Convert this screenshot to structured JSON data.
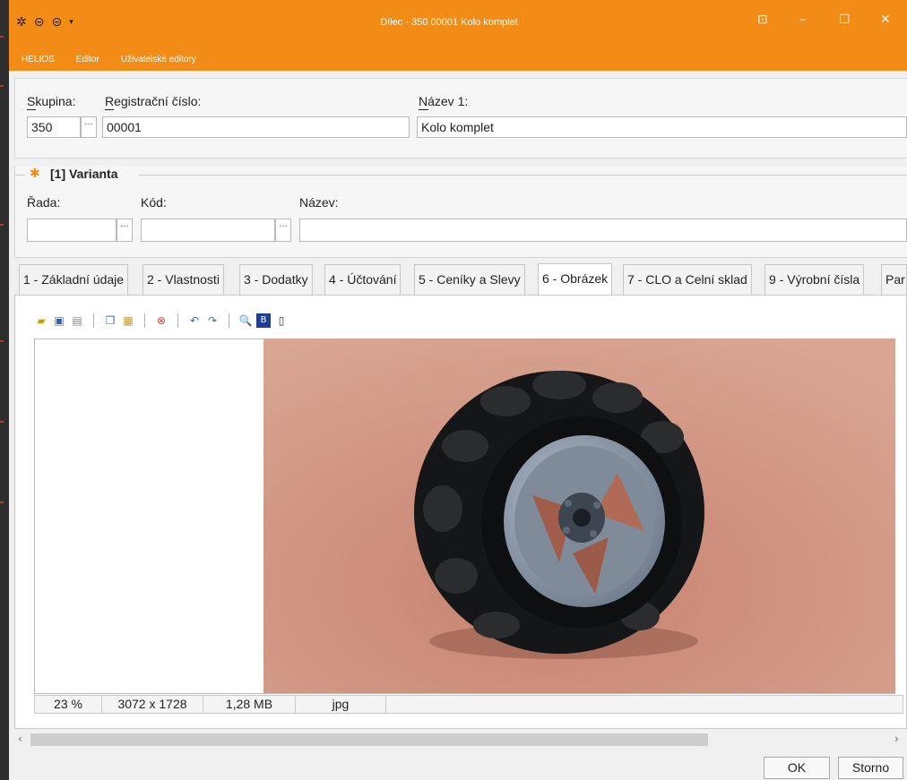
{
  "window": {
    "title": "Dílec - 350 00001 Kolo komplet",
    "controls": {
      "restore_icon": "⊡",
      "minimize": "–",
      "maximize": "☐",
      "close": "✕"
    }
  },
  "menu": {
    "items": [
      "HELIOS",
      "Editor",
      "Uživatelské editory"
    ]
  },
  "header": {
    "skupina_label": "Skupina:",
    "skupina_value": "350",
    "reg_label": "Registrační číslo:",
    "reg_value": "00001",
    "nazev1_label": "Název 1:",
    "nazev1_value": "Kolo komplet"
  },
  "varianta": {
    "title": "[1] Varianta",
    "rada_label": "Řada:",
    "kod_label": "Kód:",
    "nazev_label": "Název:",
    "rada_value": "",
    "kod_value": "",
    "nazev_value": ""
  },
  "tabs": [
    "1 - Základní údaje",
    "2 - Vlastnosti",
    "3 - Dodatky",
    "4 - Účtování",
    "5 - Ceníky a Slevy",
    "6 - Obrázek",
    "7 - CLO a Celní sklad",
    "9 - Výrobní čísla",
    "Par"
  ],
  "active_tab": "6 - Obrázek",
  "image_status": {
    "zoom": "23 %",
    "dimensions": "3072 x 1728",
    "size": "1,28 MB",
    "format": "jpg"
  },
  "buttons": {
    "ok": "OK",
    "storno": "Storno"
  },
  "colors": {
    "accent": "#f28c17",
    "photo_bg": "#c98b78"
  }
}
